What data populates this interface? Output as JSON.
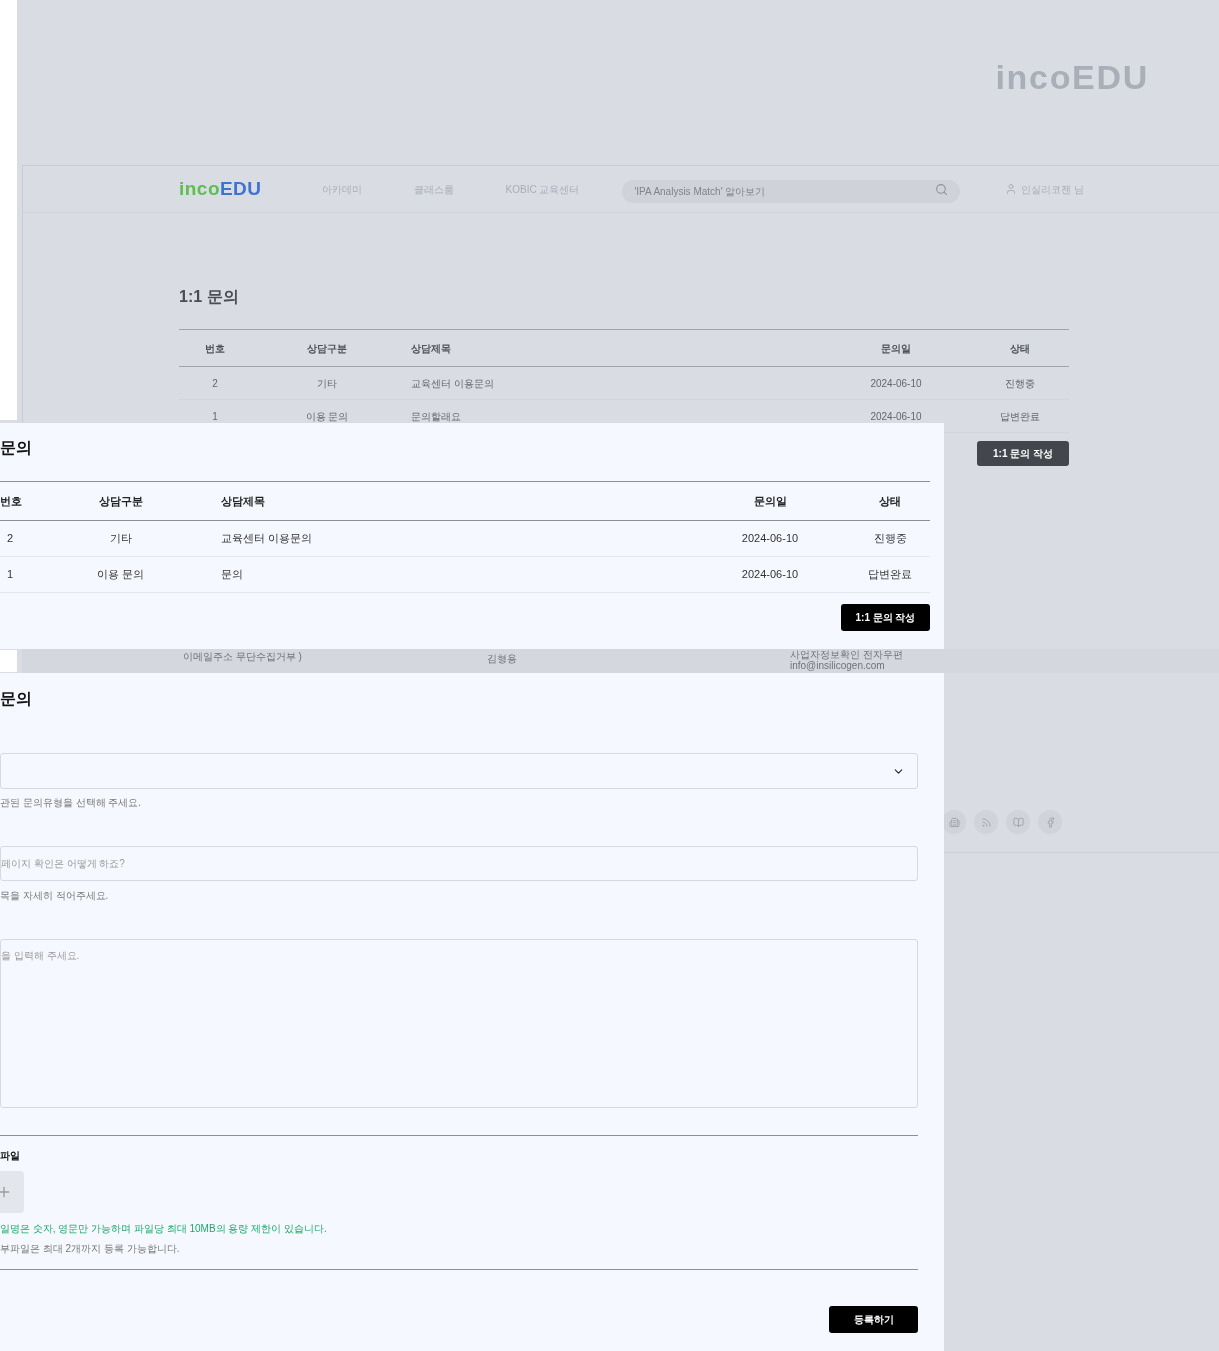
{
  "hero": {
    "logo": [
      "inco",
      "EDU"
    ]
  },
  "header": {
    "logo": [
      "inco",
      "EDU"
    ],
    "nav": [
      "아카데미",
      "클래스룸",
      "KOBIC 교육센터"
    ],
    "search": {
      "placeholder": "'IPA Analysis Match' 알아보기"
    },
    "user": "인실리코젠 님"
  },
  "page": {
    "title": "1:1 문의",
    "columns": [
      "번호",
      "상담구분",
      "상담제목",
      "문의일",
      "상태"
    ],
    "rows": [
      {
        "cells": [
          "2",
          "기타",
          "교육센터 이용문의",
          "2024-06-10",
          "진행중"
        ]
      },
      {
        "cells": [
          "1",
          "이용 문의",
          "문의할래요",
          "2024-06-10",
          "답변완료"
        ]
      }
    ],
    "button": "1:1 문의 작성"
  },
  "footer": {
    "texts": [
      "이메일주소 무단수집거부 )",
      "김형용",
      "사업자정보확인 전자우편",
      "info@insilicogen.com"
    ]
  },
  "list_panel": {
    "title": "문의",
    "columns": [
      "번호",
      "상담구분",
      "상담제목",
      "문의일",
      "상태"
    ],
    "rows": [
      {
        "cells": [
          "2",
          "기타",
          "교육센터 이용문의",
          "2024-06-10",
          "진행중"
        ]
      },
      {
        "cells": [
          "1",
          "이용 문의",
          "문의",
          "2024-06-10",
          "답변완료"
        ]
      }
    ],
    "button": "1:1 문의 작성"
  },
  "form_panel": {
    "title": "문의",
    "type_hint": "관된 문의유형을 선택해 주세요.",
    "subject": {
      "placeholder": "페이지 확인은 어떻게 하죠?"
    },
    "subject_hint": "목을 자세히 적어주세요.",
    "body": {
      "placeholder": "을 입력해 주세요."
    },
    "attach_label": "파일",
    "notes": [
      {
        "kind": "notice",
        "text": "일명은 숫자, 영문만 가능하며 파일당 최대 10MB의 용량 제한이 있습니다."
      },
      {
        "kind": "info",
        "text": "부파일은 최대 2개까지 등록 가능합니다."
      }
    ],
    "submit": "등록하기"
  }
}
